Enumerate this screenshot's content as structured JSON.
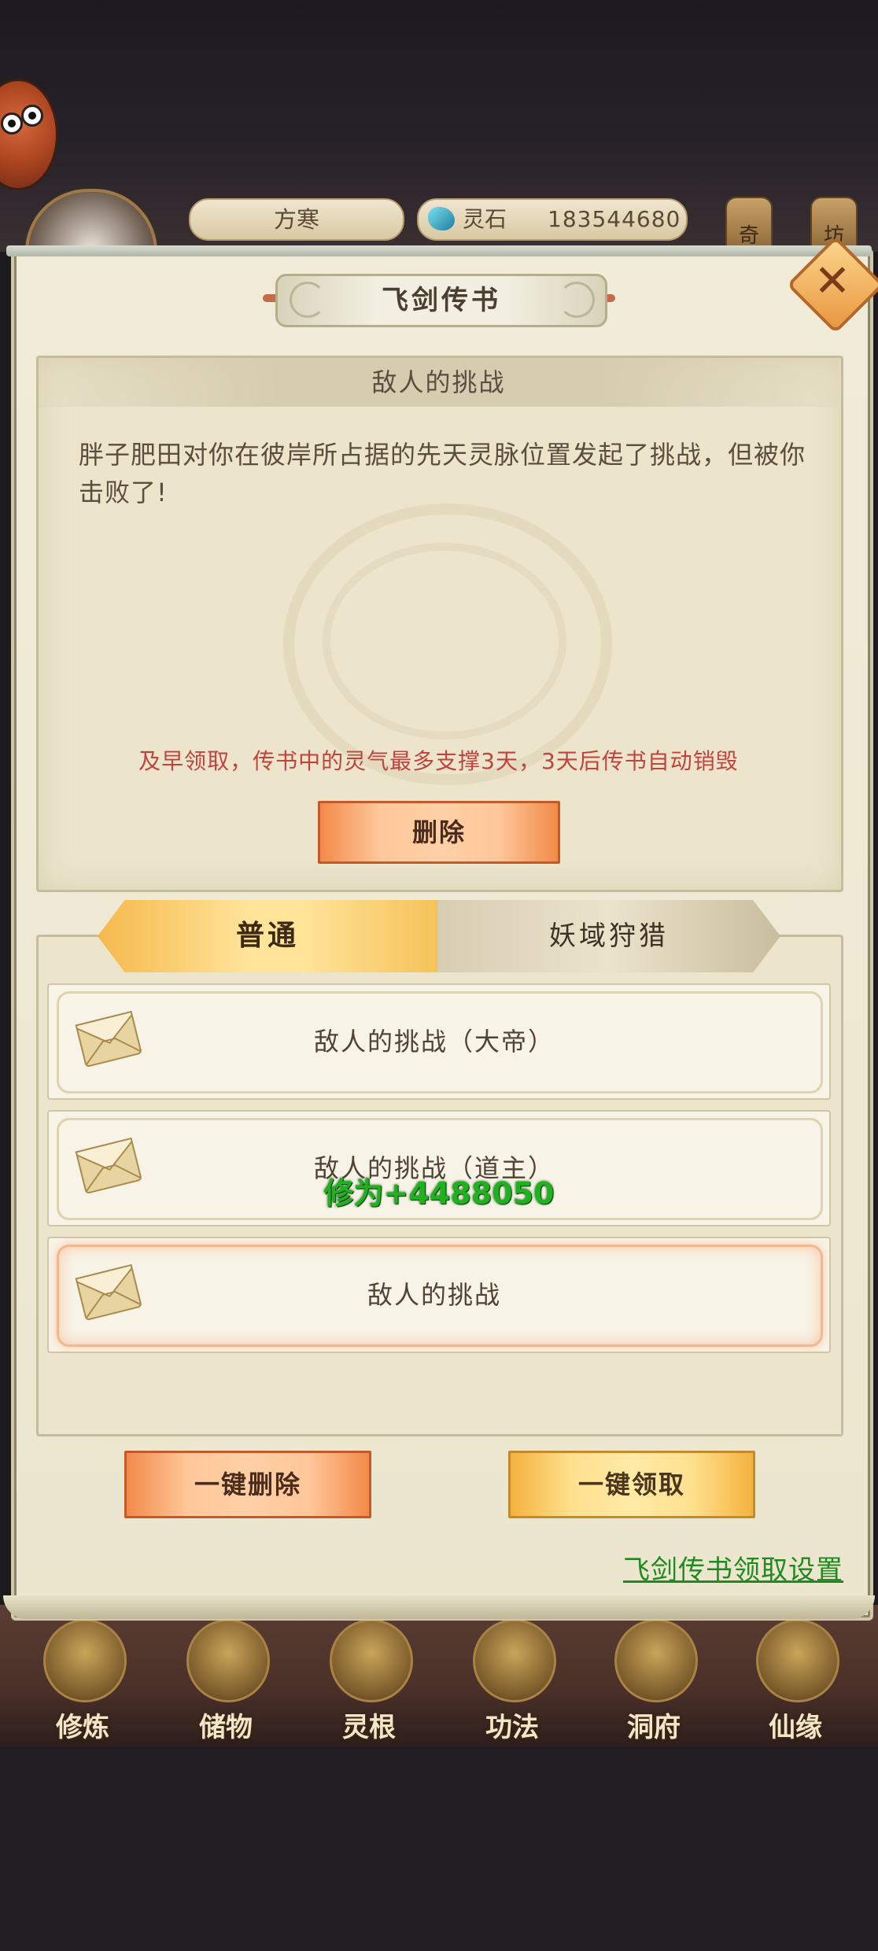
{
  "top_bar": {
    "player_name": "方寒",
    "currency_label": "灵石",
    "currency_value": "183544680",
    "side_buttons": [
      "奇",
      "坊"
    ]
  },
  "dialog": {
    "title": "飞剑传书",
    "message": {
      "title": "敌人的挑战",
      "body": "胖子肥田对你在彼岸所占据的先天灵脉位置发起了挑战，但被你击败了!",
      "note": "及早领取，传书中的灵气最多支撑3天，3天后传书自动销毁",
      "delete_label": "删除"
    },
    "tabs": [
      {
        "label": "普通",
        "active": true
      },
      {
        "label": "妖域狩猎",
        "active": false
      }
    ],
    "mail_list": [
      {
        "label": "敌人的挑战（大帝）",
        "selected": false
      },
      {
        "label": "敌人的挑战（道主）",
        "selected": false
      },
      {
        "label": "敌人的挑战",
        "selected": true
      }
    ],
    "reward_popup": "修为+4488050",
    "delete_all_label": "一键删除",
    "claim_all_label": "一键领取",
    "settings_link": "飞剑传书领取设置"
  },
  "bottom_nav": [
    {
      "label": "修炼",
      "icon": "monk-icon"
    },
    {
      "label": "储物",
      "icon": "bag-icon"
    },
    {
      "label": "灵根",
      "icon": "spirit-root-icon"
    },
    {
      "label": "功法",
      "icon": "book-icon"
    },
    {
      "label": "洞府",
      "icon": "palace-icon"
    },
    {
      "label": "仙缘",
      "icon": "gourd-icon"
    }
  ],
  "colors": {
    "note_red": "#c0443e",
    "link_green": "#1f8a1f",
    "reward_green": "#1eb31e",
    "tab_active": "#ffe49a"
  }
}
